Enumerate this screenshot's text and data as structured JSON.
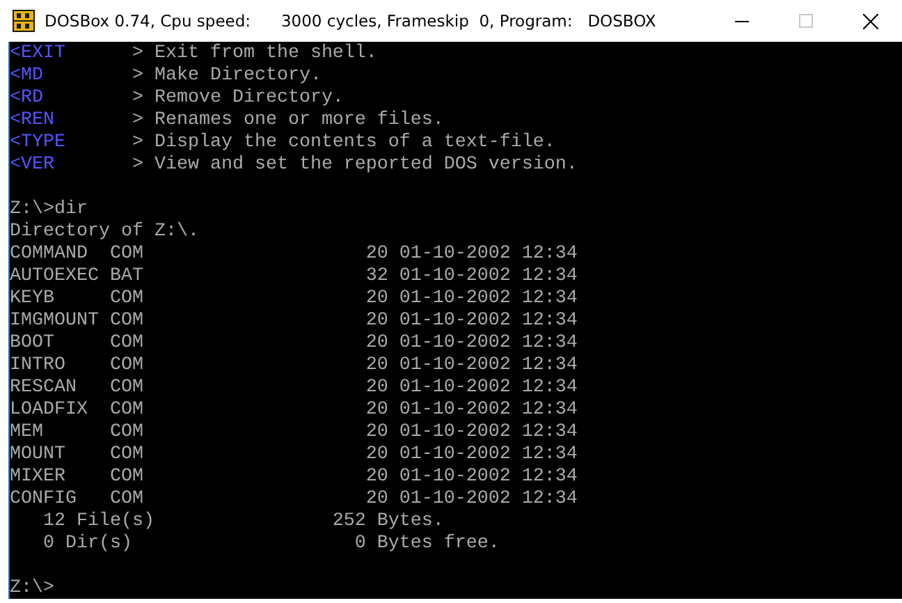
{
  "window": {
    "title": "DOSBox 0.74, Cpu speed:      3000 cycles, Frameskip  0, Program:   DOSBOX",
    "controls": [
      {
        "kind": "minimize",
        "disabled": false
      },
      {
        "kind": "maximize",
        "disabled": true
      },
      {
        "kind": "close",
        "disabled": false
      }
    ]
  },
  "terminal": {
    "lines": [
      {
        "kind": "help",
        "command": "<EXIT",
        "description": "> Exit from the shell."
      },
      {
        "kind": "help",
        "command": "<MD",
        "description": "> Make Directory."
      },
      {
        "kind": "help",
        "command": "<RD",
        "description": "> Remove Directory."
      },
      {
        "kind": "help",
        "command": "<REN",
        "description": "> Renames one or more files."
      },
      {
        "kind": "help",
        "command": "<TYPE",
        "description": "> Display the contents of a text-file."
      },
      {
        "kind": "help",
        "command": "<VER",
        "description": "> View and set the reported DOS version."
      },
      {
        "kind": "blank"
      },
      {
        "kind": "text",
        "text": "Z:\\>dir"
      },
      {
        "kind": "text",
        "text": "Directory of Z:\\."
      },
      {
        "kind": "file",
        "name": "COMMAND",
        "ext": "COM",
        "size": "20",
        "date": "01-10-2002",
        "time": "12:34"
      },
      {
        "kind": "file",
        "name": "AUTOEXEC",
        "ext": "BAT",
        "size": "32",
        "date": "01-10-2002",
        "time": "12:34"
      },
      {
        "kind": "file",
        "name": "KEYB",
        "ext": "COM",
        "size": "20",
        "date": "01-10-2002",
        "time": "12:34"
      },
      {
        "kind": "file",
        "name": "IMGMOUNT",
        "ext": "COM",
        "size": "20",
        "date": "01-10-2002",
        "time": "12:34"
      },
      {
        "kind": "file",
        "name": "BOOT",
        "ext": "COM",
        "size": "20",
        "date": "01-10-2002",
        "time": "12:34"
      },
      {
        "kind": "file",
        "name": "INTRO",
        "ext": "COM",
        "size": "20",
        "date": "01-10-2002",
        "time": "12:34"
      },
      {
        "kind": "file",
        "name": "RESCAN",
        "ext": "COM",
        "size": "20",
        "date": "01-10-2002",
        "time": "12:34"
      },
      {
        "kind": "file",
        "name": "LOADFIX",
        "ext": "COM",
        "size": "20",
        "date": "01-10-2002",
        "time": "12:34"
      },
      {
        "kind": "file",
        "name": "MEM",
        "ext": "COM",
        "size": "20",
        "date": "01-10-2002",
        "time": "12:34"
      },
      {
        "kind": "file",
        "name": "MOUNT",
        "ext": "COM",
        "size": "20",
        "date": "01-10-2002",
        "time": "12:34"
      },
      {
        "kind": "file",
        "name": "MIXER",
        "ext": "COM",
        "size": "20",
        "date": "01-10-2002",
        "time": "12:34"
      },
      {
        "kind": "file",
        "name": "CONFIG",
        "ext": "COM",
        "size": "20",
        "date": "01-10-2002",
        "time": "12:34"
      },
      {
        "kind": "summary",
        "count": "12 File(s)",
        "amount": "252 Bytes."
      },
      {
        "kind": "summary",
        "count": "0 Dir(s)",
        "amount": "0 Bytes free."
      },
      {
        "kind": "blank"
      },
      {
        "kind": "text",
        "text": "Z:\\>"
      }
    ]
  }
}
